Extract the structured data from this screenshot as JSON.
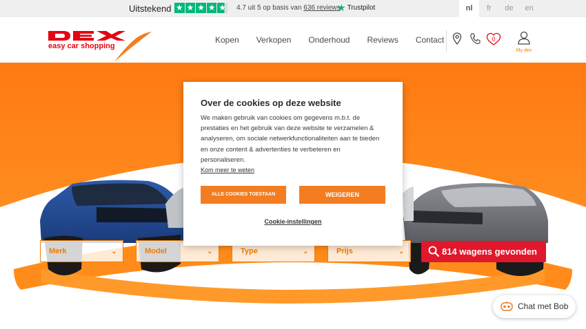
{
  "trustbar": {
    "label": "Uitstekend",
    "score_text": "4.7 uit 5 op basis van",
    "reviews_link": "636 reviews",
    "brand": "Trustpilot",
    "languages": [
      "nl",
      "fr",
      "de",
      "en"
    ],
    "active_language": "nl"
  },
  "header": {
    "logo_text": "DEX",
    "tagline": "easy car shopping",
    "nav": [
      "Kopen",
      "Verkopen",
      "Onderhoud",
      "Reviews",
      "Contact"
    ],
    "favorites_count": "0",
    "account_label": "My dex"
  },
  "filters": {
    "brand": "Merk",
    "model": "Model",
    "type": "Type",
    "price": "Prijs"
  },
  "search": {
    "label": "814 wagens gevonden"
  },
  "chat": {
    "label": "Chat met Bob"
  },
  "cookie": {
    "title": "Over de cookies op deze website",
    "body": "We maken gebruik van cookies om gegevens m.b.t. de prestaties en het gebruik van deze website te verzamelen & analyseren, om sociale netwerkfunctionaliteiten aan te bieden en onze content & advertenties te verbeteren en personaliseren.",
    "more_link": "Kom meer te weten",
    "accept_all": "ALLE COOKIES TOESTAAN",
    "deny": "WEIGEREN",
    "settings": "Cookie-instellingen"
  },
  "colors": {
    "accent_orange": "#f37d20",
    "brand_red": "#e30613",
    "search_red": "#e1172b",
    "trustpilot_green": "#00b67a"
  }
}
